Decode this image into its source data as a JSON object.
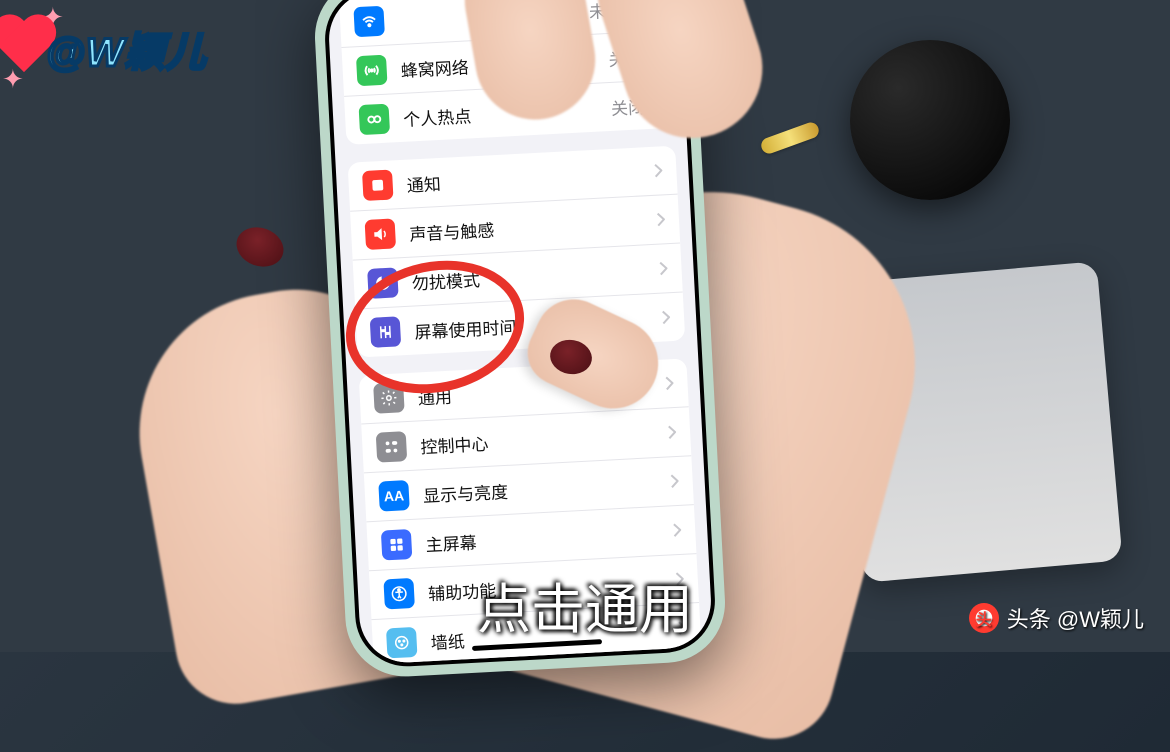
{
  "badge": {
    "handle": "@W颖儿"
  },
  "settings": {
    "group1": [
      {
        "icon": "wifi",
        "label": "",
        "value": "未连接"
      },
      {
        "icon": "cell",
        "label": "蜂窝网络",
        "value": ""
      },
      {
        "icon": "hotspot",
        "label": "个人热点",
        "value": "关闭"
      }
    ],
    "extra_value": "关闭",
    "group2": [
      {
        "icon": "notify",
        "label": "通知"
      },
      {
        "icon": "sound",
        "label": "声音与触感"
      },
      {
        "icon": "dnd",
        "label": "勿扰模式"
      },
      {
        "icon": "screen",
        "label": "屏幕使用时间"
      }
    ],
    "group3": [
      {
        "icon": "general",
        "label": "通用"
      },
      {
        "icon": "control",
        "label": "控制中心"
      },
      {
        "icon": "display",
        "label": "显示与亮度"
      },
      {
        "icon": "home",
        "label": "主屏幕"
      },
      {
        "icon": "access",
        "label": "辅助功能"
      },
      {
        "icon": "wall",
        "label": "墙纸"
      }
    ]
  },
  "caption": "点击通用",
  "source": "头条 @W颖儿"
}
